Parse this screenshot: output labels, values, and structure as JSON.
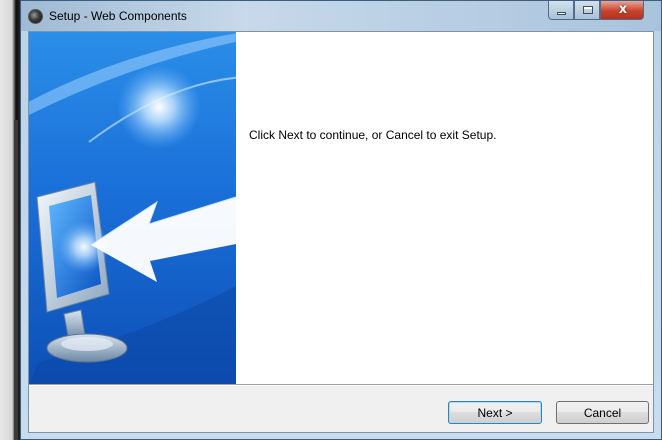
{
  "window": {
    "title": "Setup - Web Components",
    "controls": {
      "minimize_icon": "minimize-icon",
      "maximize_icon": "maximize-icon",
      "close_glyph": "x"
    }
  },
  "content": {
    "message": "Click Next to continue, or Cancel to exit Setup."
  },
  "buttons": {
    "next_label": "Next >",
    "cancel_label": "Cancel"
  },
  "colors": {
    "banner_blue": "#1a6fd6",
    "close_red": "#c8442c",
    "default_button_border": "#3c7fb1"
  }
}
